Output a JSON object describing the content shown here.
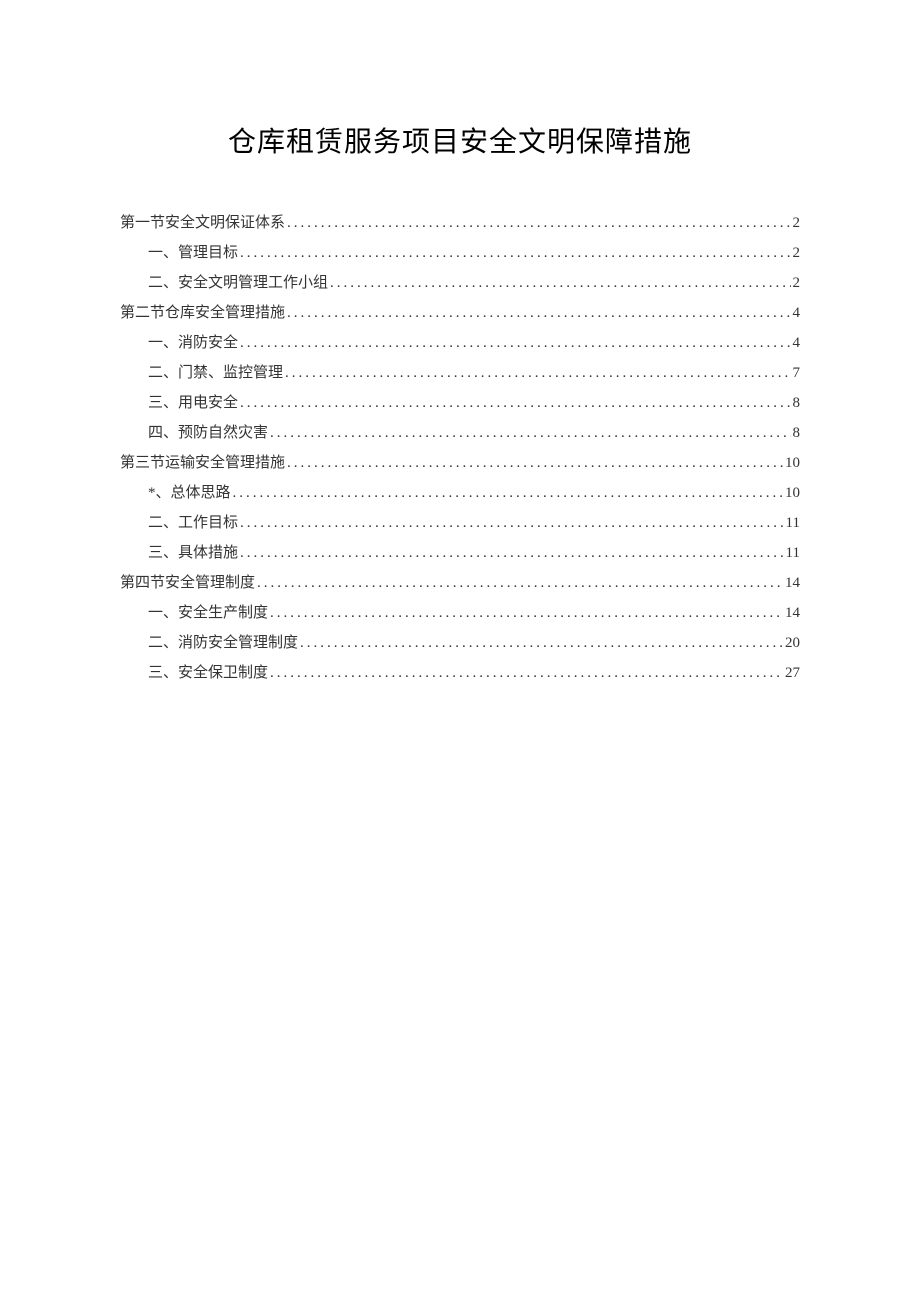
{
  "title": "仓库租赁服务项目安全文明保障措施",
  "toc": [
    {
      "level": 0,
      "label": "第一节安全文明保证体系",
      "page": "2"
    },
    {
      "level": 1,
      "label": "一、管理目标",
      "page": "2"
    },
    {
      "level": 1,
      "label": "二、安全文明管理工作小组",
      "page": "2"
    },
    {
      "level": 0,
      "label": "第二节仓库安全管理措施",
      "page": "4"
    },
    {
      "level": 1,
      "label": "一、消防安全",
      "page": "4"
    },
    {
      "level": 1,
      "label": "二、门禁、监控管理",
      "page": "7"
    },
    {
      "level": 1,
      "label": "三、用电安全",
      "page": "8"
    },
    {
      "level": 1,
      "label": "四、预防自然灾害",
      "page": "8"
    },
    {
      "level": 0,
      "label": "第三节运输安全管理措施",
      "page": "10"
    },
    {
      "level": 1,
      "label": "*、总体思路",
      "page": "10"
    },
    {
      "level": 1,
      "label": "二、工作目标",
      "page": "11"
    },
    {
      "level": 1,
      "label": "三、具体措施",
      "page": "11"
    },
    {
      "level": 0,
      "label": "第四节安全管理制度",
      "page": "14"
    },
    {
      "level": 1,
      "label": "一、安全生产制度",
      "page": "14"
    },
    {
      "level": 1,
      "label": "二、消防安全管理制度",
      "page": "20"
    },
    {
      "level": 1,
      "label": "三、安全保卫制度",
      "page": "27"
    }
  ]
}
